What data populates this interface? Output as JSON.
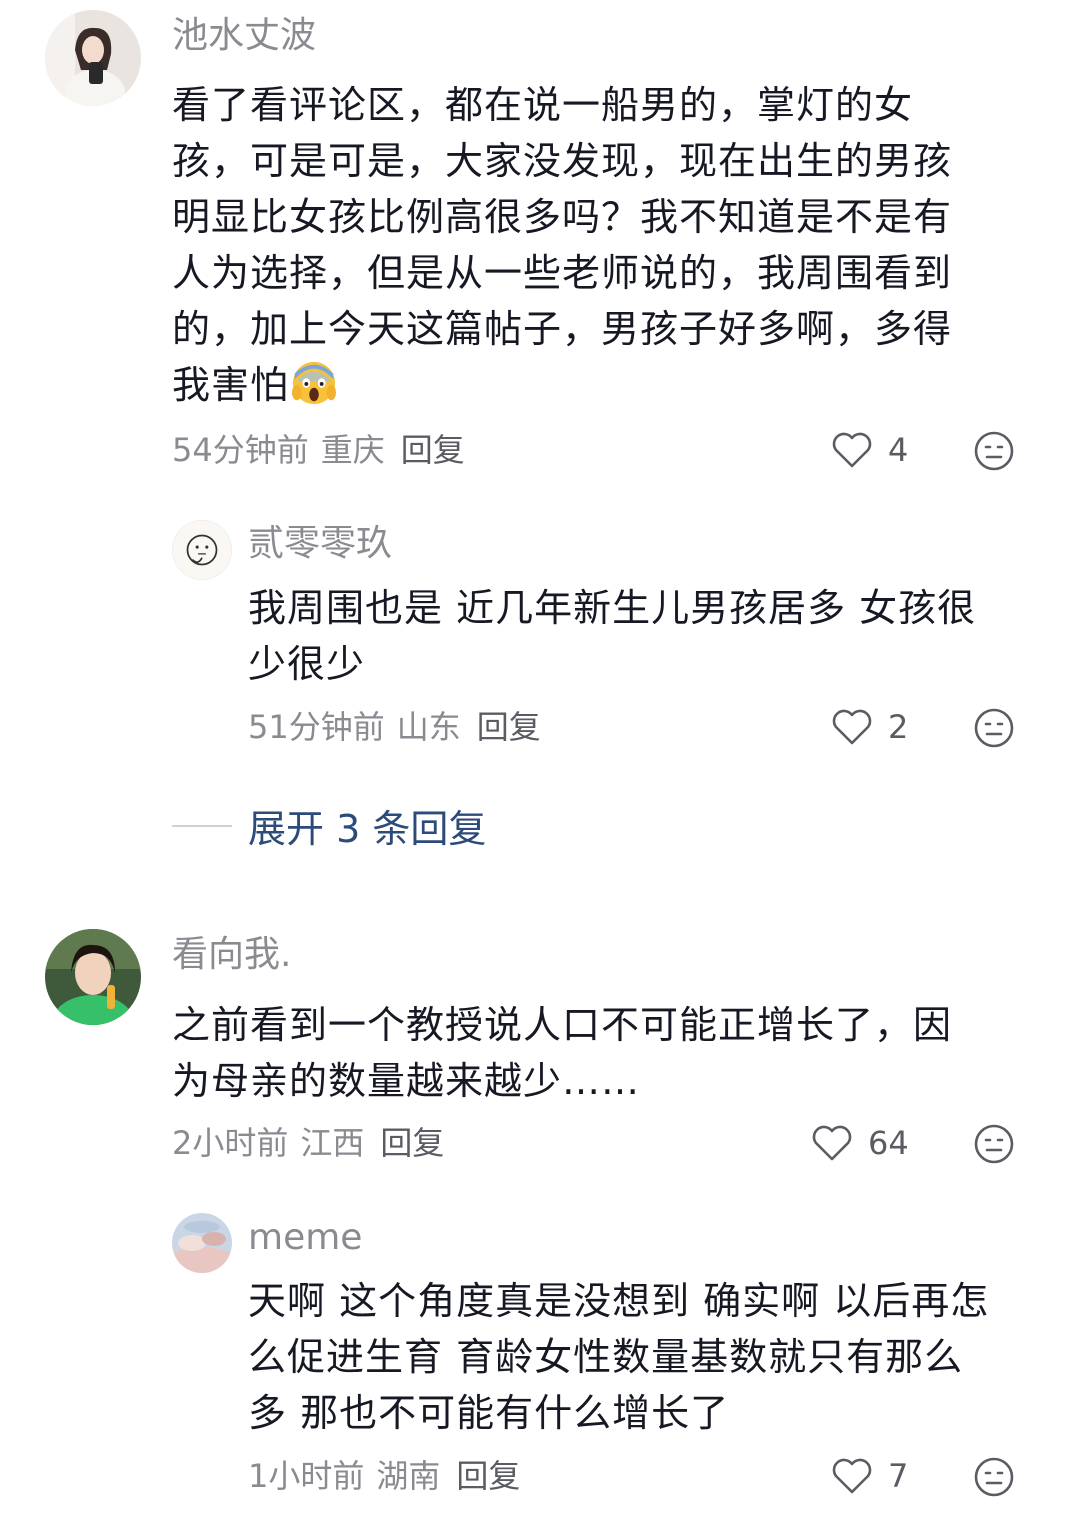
{
  "comments": [
    {
      "username": "池水丈波",
      "lines": [
        "看了看评论区，都在说一船男的，掌灯的女",
        "孩，可是可是，大家没发现，现在出生的男孩",
        "明显比女孩比例高很多吗？我不知道是不是有",
        "人为选择，但是从一些老师说的，我周围看到",
        "的，加上今天这篇帖子，男孩子好多啊，多得",
        "我害怕"
      ],
      "emoji": "screaming-face",
      "time": "54分钟前",
      "location": "重庆",
      "reply_label": "回复",
      "likes": "4",
      "replies": [
        {
          "username": "贰零零玖",
          "lines": [
            "我周围也是 近几年新生儿男孩居多 女孩很",
            "少很少"
          ],
          "time": "51分钟前",
          "location": "山东",
          "reply_label": "回复",
          "likes": "2"
        }
      ],
      "expand_label": "展开 3 条回复"
    },
    {
      "username": "看向我.",
      "lines": [
        "之前看到一个教授说人口不可能正增长了，因",
        "为母亲的数量越来越少……"
      ],
      "time": "2小时前",
      "location": "江西",
      "reply_label": "回复",
      "likes": "64",
      "replies": [
        {
          "username": "meme",
          "lines": [
            "天啊 这个角度真是没想到 确实啊 以后再怎",
            "么促进生育 育龄女性数量基数就只有那么",
            "多 那也不可能有什么增长了"
          ],
          "time": "1小时前",
          "location": "湖南",
          "reply_label": "回复",
          "likes": "7"
        }
      ]
    }
  ],
  "colors": {
    "text": "#161823",
    "secondary": "#8a8b91",
    "expand_link": "#2d4b7a",
    "background": "#ffffff"
  }
}
